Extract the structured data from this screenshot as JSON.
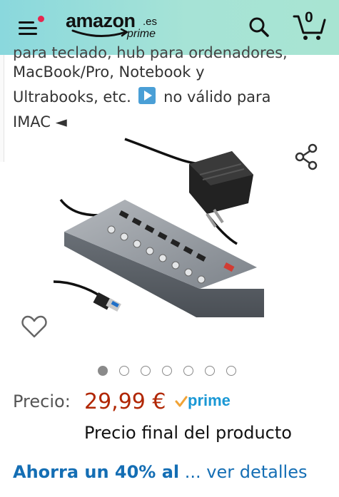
{
  "header": {
    "logo_word": "amazon",
    "logo_tld": ".es",
    "logo_prime": "prime",
    "cart_count": "0",
    "menu_icon": "hamburger-menu-icon",
    "search_icon": "search-icon",
    "cart_icon": "cart-icon",
    "notification_color": "#e6264f"
  },
  "product": {
    "title_cut": "para teclado, hub para ordenadores, laptop, MacBook,",
    "title_line1": "MacBook/Pro, Notebook y",
    "title_line2_a": "Ultrabooks, etc.",
    "title_line2_b": "no válido para",
    "title_line3": "IMAC ◄",
    "image_alt": "USB hub with power adapter",
    "image_count": 7,
    "active_image": 1
  },
  "price": {
    "label": "Precio:",
    "value": "29,99 €",
    "prime_label": "prime",
    "final_note": "Precio final del producto",
    "color": "#b12704"
  },
  "promo": {
    "text": "Ahorra un 40% al",
    "more": " ... ver detalles",
    "color": "#146eb4"
  }
}
